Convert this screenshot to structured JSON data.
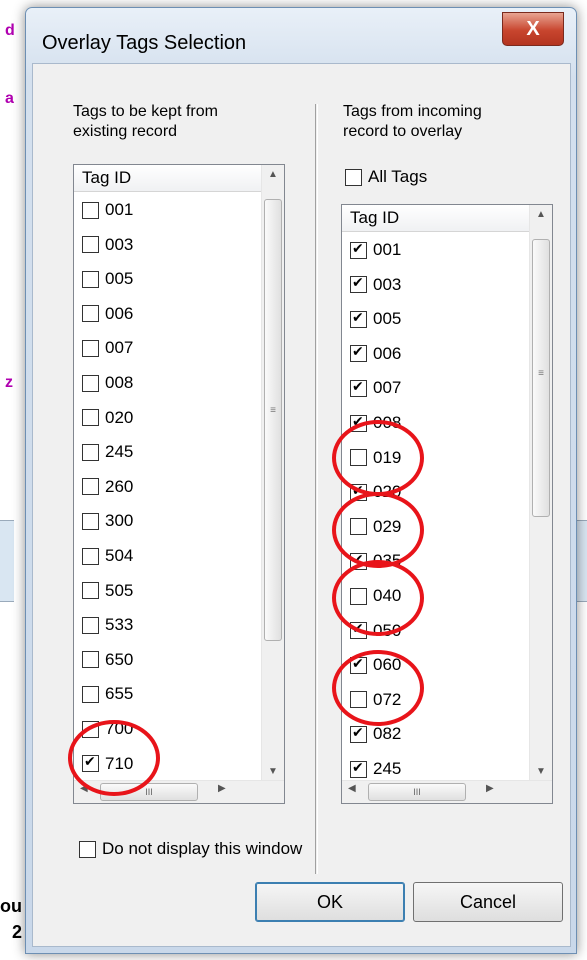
{
  "dialog": {
    "title": "Overlay Tags Selection",
    "close_label": "X"
  },
  "left_panel": {
    "caption_line1": "Tags to be kept from",
    "caption_line2": "existing record",
    "column_header": "Tag ID",
    "items": [
      {
        "label": "001",
        "checked": false
      },
      {
        "label": "003",
        "checked": false
      },
      {
        "label": "005",
        "checked": false
      },
      {
        "label": "006",
        "checked": false
      },
      {
        "label": "007",
        "checked": false
      },
      {
        "label": "008",
        "checked": false
      },
      {
        "label": "020",
        "checked": false
      },
      {
        "label": "245",
        "checked": false
      },
      {
        "label": "260",
        "checked": false
      },
      {
        "label": "300",
        "checked": false
      },
      {
        "label": "504",
        "checked": false
      },
      {
        "label": "505",
        "checked": false
      },
      {
        "label": "533",
        "checked": false
      },
      {
        "label": "650",
        "checked": false
      },
      {
        "label": "655",
        "checked": false
      },
      {
        "label": "700",
        "checked": false
      },
      {
        "label": "710",
        "checked": true
      }
    ]
  },
  "right_panel": {
    "caption_line1": "Tags from incoming",
    "caption_line2": "record to overlay",
    "all_tags_label": "All Tags",
    "all_tags_checked": false,
    "column_header": "Tag ID",
    "items": [
      {
        "label": "001",
        "checked": true
      },
      {
        "label": "003",
        "checked": true
      },
      {
        "label": "005",
        "checked": true
      },
      {
        "label": "006",
        "checked": true
      },
      {
        "label": "007",
        "checked": true
      },
      {
        "label": "008",
        "checked": true
      },
      {
        "label": "019",
        "checked": false
      },
      {
        "label": "020",
        "checked": true
      },
      {
        "label": "029",
        "checked": false
      },
      {
        "label": "035",
        "checked": true
      },
      {
        "label": "040",
        "checked": false
      },
      {
        "label": "050",
        "checked": true
      },
      {
        "label": "060",
        "checked": true
      },
      {
        "label": "072",
        "checked": false
      },
      {
        "label": "082",
        "checked": true
      },
      {
        "label": "245",
        "checked": true
      }
    ]
  },
  "footer": {
    "dont_display_label": "Do not display this window",
    "dont_display_checked": false,
    "ok_label": "OK",
    "cancel_label": "Cancel"
  },
  "background": {
    "letters": [
      "d",
      "a",
      "z"
    ],
    "bottom_text_1": "ou",
    "bottom_text_2": "2"
  },
  "colors": {
    "highlight_circle": "#e8141a",
    "title_bar": "#d4e0ee",
    "close_button": "#c8452e"
  }
}
